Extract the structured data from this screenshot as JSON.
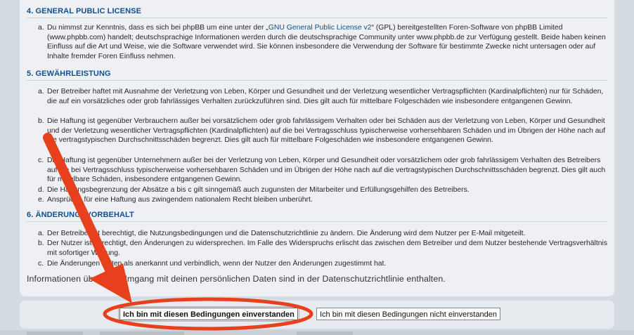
{
  "sections": [
    {
      "heading": "4. GENERAL PUBLIC LICENSE",
      "items": [
        {
          "marker": "a.",
          "before": "Du nimmst zur Kenntnis, dass es sich bei phpBB um eine unter der „",
          "link": "GNU General Public License v2",
          "after": "“ (GPL) bereitgestellten Foren-Software von phpBB Limited (www.phpbb.com) handelt; deutschsprachige Informationen werden durch die deutschsprachige Community unter www.phpbb.de zur Verfügung gestellt. Beide haben keinen Einfluss auf die Art und Weise, wie die Software verwendet wird. Sie können insbesondere die Verwendung der Software für bestimmte Zwecke nicht untersagen oder auf Inhalte fremder Foren Einfluss nehmen."
        }
      ]
    },
    {
      "heading": "5. GEWÄHRLEISTUNG",
      "items": [
        {
          "marker": "a.",
          "text": "Der Betreiber haftet mit Ausnahme der Verletzung von Leben, Körper und Gesundheit und der Verletzung wesentlicher Vertragspflichten (Kardinalpflichten) nur für Schäden, die auf ein vorsätzliches oder grob fahrlässiges Verhalten zurückzuführen sind. Dies gilt auch für mittelbare Folgeschäden wie insbesondere entgangenen Gewinn."
        },
        {
          "marker": "b.",
          "text": "Die Haftung ist gegenüber Verbrauchern außer bei vorsätzlichem oder grob fahrlässigem Verhalten oder bei Schäden aus der Verletzung von Leben, Körper und Gesundheit und der Verletzung wesentlicher Vertragspflichten (Kardinalpflichten) auf die bei Vertragsschluss typischerweise vorhersehbaren Schäden und im Übrigen der Höhe nach auf die vertragstypischen Durchschnittsschäden begrenzt. Dies gilt auch für mittelbare Folgeschäden wie insbesondere entgangenen Gewinn."
        },
        {
          "marker": "c.",
          "text": "Die Haftung ist gegenüber Unternehmern außer bei der Verletzung von Leben, Körper und Gesundheit oder vorsätzlichem oder grob fahrlässigem Verhalten des Betreibers auf die bei Vertragsschluss typischerweise vorhersehbaren Schäden und im Übrigen der Höhe nach auf die vertragstypischen Durchschnittsschäden begrenzt. Dies gilt auch für mittelbare Schäden, insbesondere entgangenen Gewinn."
        },
        {
          "marker": "d.",
          "text": "Die Haftungsbegrenzung der Absätze a bis c gilt sinngemäß auch zugunsten der Mitarbeiter und Erfüllungsgehilfen des Betreibers."
        },
        {
          "marker": "e.",
          "text": "Ansprüche für eine Haftung aus zwingendem nationalem Recht bleiben unberührt."
        }
      ]
    },
    {
      "heading": "6. ÄNDERUNGSVORBEHALT",
      "items": [
        {
          "marker": "a.",
          "text": "Der Betreiber ist berechtigt, die Nutzungsbedingungen und die Datenschutzrichtlinie zu ändern. Die Änderung wird dem Nutzer per E-Mail mitgeteilt."
        },
        {
          "marker": "b.",
          "text": "Der Nutzer ist berechtigt, den Änderungen zu widersprechen. Im Falle des Widerspruchs erlischt das zwischen dem Betreiber und dem Nutzer bestehende Vertragsverhältnis mit sofortiger Wirkung."
        },
        {
          "marker": "c.",
          "text": "Die Änderungen gelten als anerkannt und verbindlich, wenn der Nutzer den Änderungen zugestimmt hat."
        }
      ]
    }
  ],
  "privacy_note": "Informationen über den Umgang mit deinen persönlichen Daten sind in der Datenschutzrichtlinie enthalten.",
  "buttons": {
    "agree": "Ich bin mit diesen Bedingungen einverstanden",
    "disagree": "Ich bin mit diesen Bedingungen nicht einverstanden"
  },
  "colors": {
    "heading": "#11508e",
    "link": "#105289",
    "annotation": "#e8401c"
  },
  "icons": {
    "annotation_arrow": "red-arrow-icon",
    "annotation_circle": "red-ellipse-highlight"
  }
}
